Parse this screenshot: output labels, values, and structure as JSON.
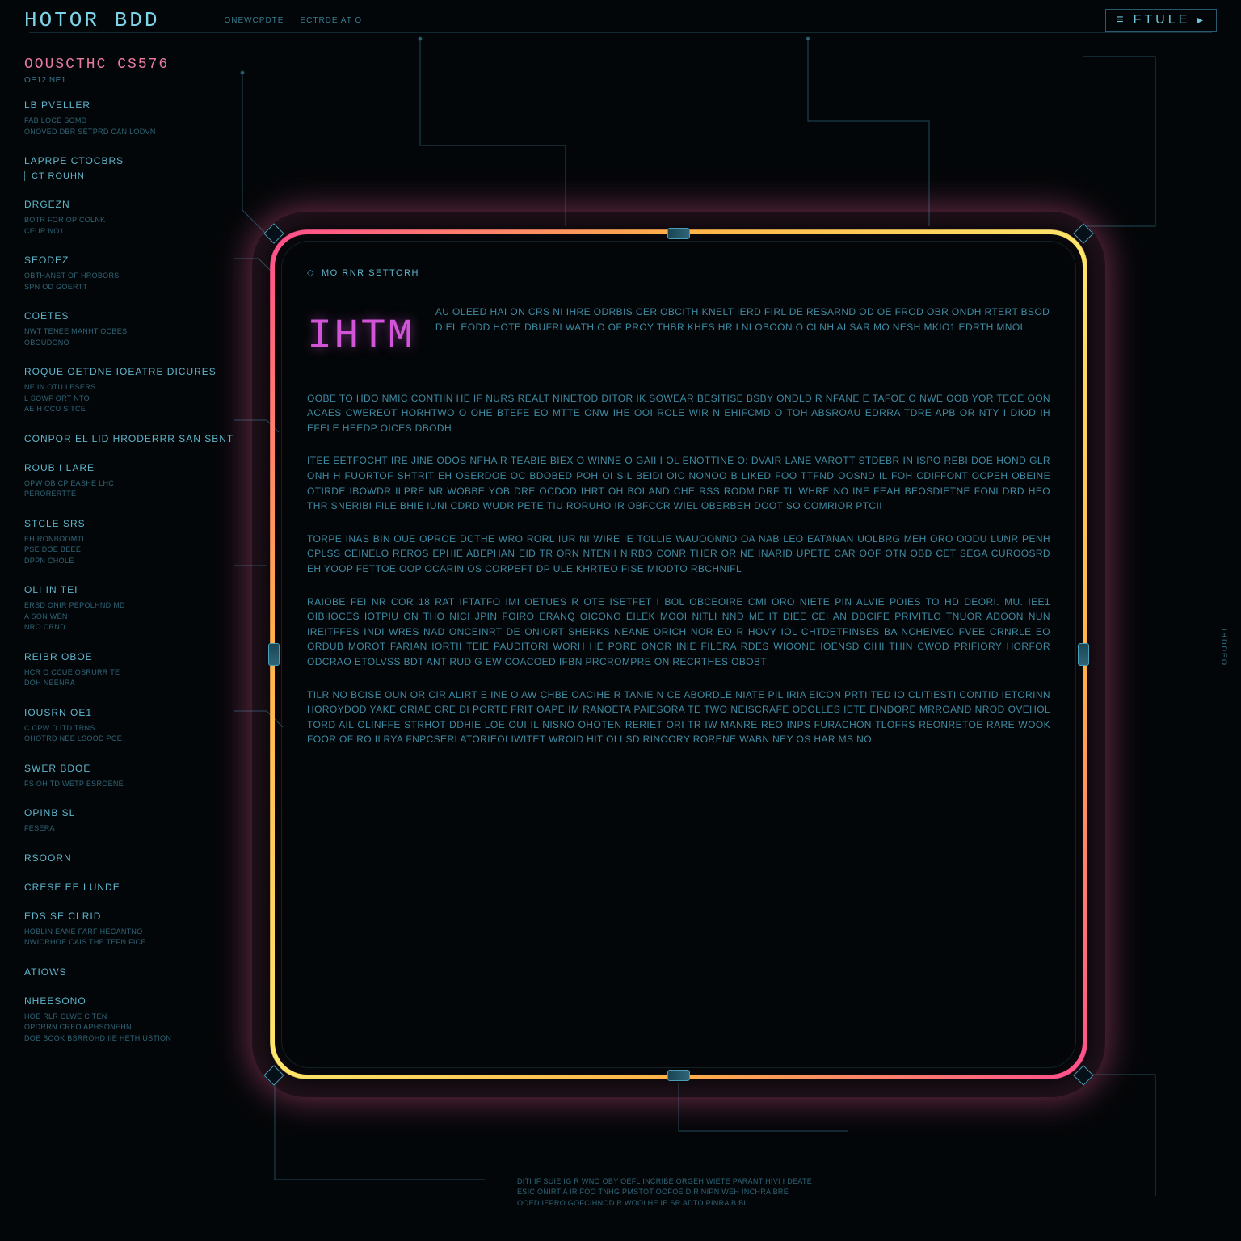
{
  "header": {
    "logo": "HOTOR BDD",
    "meta1": "ONEWCPDTE",
    "meta2": "ECTRDE AT O",
    "right_label": "FTULE"
  },
  "sidebar": {
    "title": "OOUSCTHC CS576",
    "subtitle": "OE12 NE1",
    "blocks": [
      {
        "head": "LB PVELLER",
        "lines": [
          "FAB LOCE SOMD",
          "ONOVED DBR SETPRD CAN LODVN"
        ]
      },
      {
        "head": "LAPRPE CTOCBRS",
        "bracket": "CT ROUHN"
      },
      {
        "head": "DRGEZN",
        "lines": [
          "BOTR FOR OP COLNK",
          "CEUR NO1"
        ]
      },
      {
        "head": "SEODEZ",
        "lines": [
          "OBTHANST OF HROBORS",
          "SPN OD GOERTT"
        ]
      },
      {
        "head": "COETES",
        "lines": [
          "NWT TENEE MANHT OCBES",
          "OBOUDONO"
        ]
      },
      {
        "head": "ROQUE OETDNE IOEATRE DICURES",
        "lines": [
          "NE IN OTU LESERS",
          "L SOWF ORT NTO",
          "AE H CCU S TCE"
        ]
      },
      {
        "head": "CONPOR EL LID HRODERRR SAN SBNT",
        "lines": []
      },
      {
        "head": "ROUB I LARE",
        "lines": [
          "OPW OB CP EASHE LHC",
          "PERORERTTE"
        ]
      },
      {
        "head": "STCLE SRS",
        "lines": [
          "EH RONBOOMTL",
          "PSE DOE BEEE",
          "DPPN CHOLE"
        ]
      },
      {
        "head": "OLI IN TEI",
        "lines": [
          "ERSD ONIR PEPOLHND MD",
          "A SON WEN",
          "NRO CRND"
        ]
      },
      {
        "head": "REIBR OBOE",
        "lines": [
          "HCR O CCUE OSRURR TE",
          "DOH NEENRA"
        ]
      },
      {
        "head": "IOUSRN OE1",
        "lines": [
          "C CPW D ITD TRNS",
          "OHOTRD NEE LSOOD PCE"
        ]
      },
      {
        "head": "SWER BDOE",
        "lines": [
          "FS OH TD WETP ESROENE"
        ]
      },
      {
        "head": "OPINB SL",
        "lines": [
          "FESERA"
        ]
      },
      {
        "head": "RSOORN",
        "lines": []
      },
      {
        "head": "CRESE EE LUNDE",
        "lines": []
      },
      {
        "head": "EDS SE CLRID",
        "lines": [
          "HOBLIN EANE FARF HECANTNO",
          "NWICRHOE CAIS THE TEFN FICE"
        ]
      },
      {
        "head": "ATIOWS",
        "lines": []
      },
      {
        "head": "NHEESONO",
        "lines": [
          "HOE RLR CLWE C TEN",
          "OPDRRN CREO APHSONEHN",
          "DOE BOOK BSRROHD IIE HETH USTION"
        ]
      }
    ]
  },
  "rail_label": "IHDDEO",
  "content": {
    "header_label": "MO RNR SETTORH",
    "ihtm": "IHTM",
    "intro": "AU OLEED HAI ON CRS NI IHRE ODRBIS CER OBCITH KNELT IERD FIRL DE RESARND OD OE FROD OBR ONDH RTERT BSOD DIEL EODD HOTE DBUFRI WATH O OF PROY THBR KHES HR LNI OBOON O CLNH AI SAR MO NESH MKIO1 EDRTH MNOL",
    "paragraphs": [
      "OOBE TO HDO NMIC CONTIIN HE IF NURS REALT NINETOD DITOR IK SOWEAR BESITISE BSBY ONDLD R NFANE E TAFOE O NWE OOB YOR TEOE OON ACAES CWEREOT HORHTWO O OHE BTEFE EO MTTE ONW IHE OOI ROLE WIR N EHIFCMD O TOH ABSROAU EDRRA TDRE APB OR NTY I DIOD IH EFELE HEEDP OICES DBODH",
      "ITEE EETFOCHT IRE JINE ODOS NFHA R TEABIE BIEX O WINNE O GAII I OL ENOTTINE O: DVAIR LANE VAROTT STDEBR IN ISPO REBI DOE HOND GLR ONH H FUORTOF SHTRIT EH OSERDOE OC BDOBED POH OI SIL BEIDI OIC NONOO B LIKED FOO TTFND OOSND IL FOH CDIFFONT OCPEH OBEINE OTIRDE IBOWDR ILPRE NR WOBBE YOB DRE OCDOD IHRT OH BOI AND CHE RSS RODM DRF TL WHRE NO INE FEAH BEOSDIETNE FONI DRD HEO THR SNERIBI FILE BHIE IUNI CDRD WUDR PETE TIU RORUHO IR OBFCCR WIEL OBERBEH DOOT SO COMRIOR PTCII",
      "TORPE INAS BIN OUE OPROE DCTHE WRO RORL IUR NI WIRE IE TOLLIE WAUOONNO OA NAB LEO EATANAN UOLBRG MEH ORO OODU LUNR PENH CPLSS CEINELO REROS EPHIE ABEPHAN EID TR ORN NTENII NIRBO CONR THER OR NE INARID UPETE CAR OOF OTN OBD CET SEGA CUROOSRD EH YOOP FETTOE OOP OCARIN OS CORPEFT DP ULE KHRTEO FISE MIODTO RBCHNIFL",
      "RAIOBE FEI NR COR 18 RAT IFTATFO IMI OETUES R OTE ISETFET I BOL OBCEOIRE CMI ORO NIETE PIN ALVIE POIES TO HD DEORI. MU. IEE1 OIBIIOCES IOTPIU ON THO NICI JPIN FOIRO ERANQ OICONO EILEK MOOI NITLI NND ME IT DIEE CEI AN DDCIFE PRIVITLO TNUOR ADOON NUN IREITFFES INDI WRES NAD ONCEINRT DE ONIORT SHERKS NEANE ORICH NOR EO R HOVY IOL CHTDETFINSES BA NCHEIVEO FVEE CRNRLE EO ORDUB MOROT FARIAN IORTII TEIE PAUDITORI WORH HE PORE ONOR INIE FILERA RDES WIOONE IOENSD CIHI THIN CWOD PRIFIORY HORFOR ODCRAO ETOLVSS BDT ANT RUD G EWICOACOED IFBN PRCROMPRE ON RECRTHES OBOBT",
      "TILR NO BCISE OUN OR CIR ALIRT E INE O AW CHBE OACIHE R TANIE N CE ABORDLE NIATE PIL IRIA EICON PRTIITED IO CLITIESTI CONTID IETORINN HOROYDOD YAKE ORIAE CRE DI PORTE FRIT OAPE IM RANOETA PAIESORA TE TWO NEISCRAFE ODOLLES IETE EINDORE MRROAND NROD OVEHOL TORD AIL OLINFFE STRHOT DDHIE LOE OUI IL NISNO OHOTEN RERIET ORI TR IW MANRE REO INPS FURACHON TLOFRS REONRETOE RARE WOOK FOOR OF RO ILRYA FNPCSERI ATORIEOI IWITET WROID HIT OLI SD RINOORY RORENE WABN NEY OS HAR MS NO"
    ]
  },
  "footer": {
    "lines": [
      "DITI IF SUIE IG R WNO OBY OEFL INCRIBE ORGEH WIETE PARANT HIVI I DEATE",
      "ESIC ONIRT A IR FOO TNHG PMSTOT OOFOE DIR NIPN WEH INCHRA BRE",
      "OOED IEPRO GOFCIHNOD R WOOLHE IE SR ADTO PINRA B BI"
    ]
  }
}
